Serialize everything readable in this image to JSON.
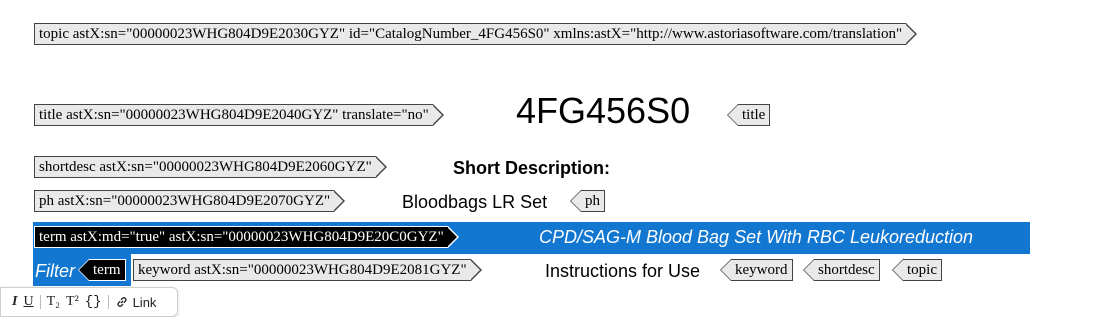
{
  "tags": {
    "topic_open": "topic astX:sn=\"00000023WHG804D9E2030GYZ\" id=\"CatalogNumber_4FG456S0\" xmlns:astX=\"http://www.astoriasoftware.com/translation\"",
    "title_open": "title astX:sn=\"00000023WHG804D9E2040GYZ\" translate=\"no\"",
    "title_close": "title",
    "shortdesc_open": "shortdesc astX:sn=\"00000023WHG804D9E2060GYZ\"",
    "ph_open": "ph astX:sn=\"00000023WHG804D9E2070GYZ\"",
    "ph_close": "ph",
    "term_open": "term astX:md=\"true\" astX:sn=\"00000023WHG804D9E20C0GYZ\"",
    "term_close": "term",
    "keyword_open": "keyword astX:sn=\"00000023WHG804D9E2081GYZ\"",
    "keyword_close": "keyword",
    "shortdesc_close": "shortdesc",
    "topic_close": "topic"
  },
  "content": {
    "title_text": "4FG456S0",
    "shortdesc_label": "Short Description:",
    "ph_text": "Bloodbags LR Set",
    "term_text_line1": "CPD/SAG-M Blood Bag Set With RBC Leukoreduction",
    "term_text_line2": "Filter",
    "keyword_text": "Instructions for Use"
  },
  "colors": {
    "selection": "#1177d1",
    "tag_fill": "#e9e9e9",
    "tag_border": "#444444"
  },
  "toolbar": {
    "items": [
      {
        "icon": "italic-icon",
        "label": "I"
      },
      {
        "icon": "underline-icon",
        "label": "U"
      },
      {
        "icon": "subscript-icon",
        "label": "T₂"
      },
      {
        "icon": "superscript-icon",
        "label": "T²"
      },
      {
        "icon": "braces-icon",
        "label": "{}"
      },
      {
        "icon": "link-icon",
        "label": "Link"
      }
    ]
  }
}
